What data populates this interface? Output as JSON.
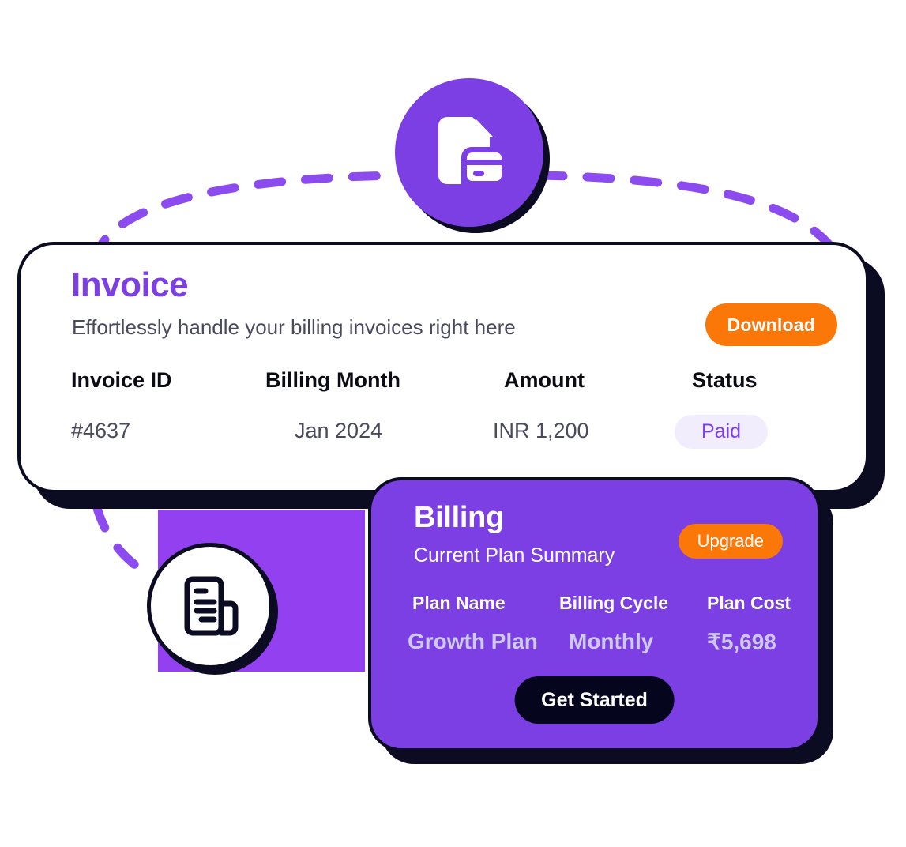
{
  "invoice_card": {
    "title": "Invoice",
    "subtitle": "Effortlessly handle your billing invoices right here",
    "download_label": "Download",
    "columns": [
      "Invoice ID",
      "Billing Month",
      "Amount",
      "Status"
    ],
    "row": {
      "invoice_id": "#4637",
      "billing_month": "Jan 2024",
      "amount": "INR 1,200",
      "status": "Paid"
    }
  },
  "billing_card": {
    "title": "Billing",
    "subtitle": "Current Plan Summary",
    "upgrade_label": "Upgrade",
    "columns": [
      "Plan Name",
      "Billing Cycle",
      "Plan Cost"
    ],
    "row": {
      "plan_name": "Growth Plan",
      "billing_cycle": "Monthly",
      "plan_cost": "₹5,698"
    },
    "cta_label": "Get Started"
  },
  "icons": {
    "top_badge": "invoice-card-icon",
    "bottom_badge": "receipt-document-icon"
  },
  "colors": {
    "purple": "#7B3FE4",
    "purple_block": "#9340F0",
    "orange": "#FB7707",
    "dark": "#0B0B21",
    "near_black": "#05061E",
    "pill_bg": "#F2EDFD",
    "value_lavender": "#CFC9F0",
    "subtitle_gray": "#4A4A5E"
  }
}
